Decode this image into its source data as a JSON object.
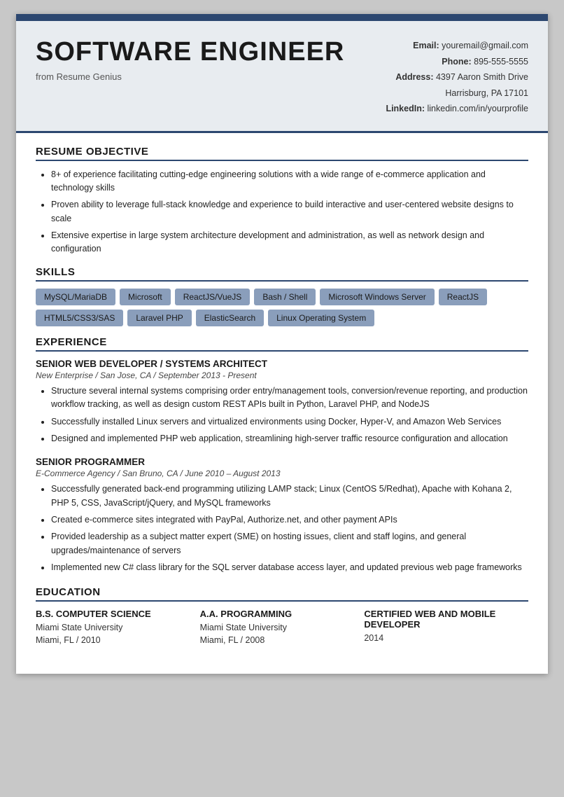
{
  "header": {
    "title": "SOFTWARE ENGINEER",
    "subtitle": "from Resume Genius",
    "contact": {
      "email_label": "Email:",
      "email_value": "youremail@gmail.com",
      "phone_label": "Phone:",
      "phone_value": "895-555-5555",
      "address_label": "Address:",
      "address_line1": "4397 Aaron Smith Drive",
      "address_line2": "Harrisburg, PA 17101",
      "linkedin_label": "LinkedIn:",
      "linkedin_value": "linkedin.com/in/yourprofile"
    }
  },
  "sections": {
    "objective": {
      "title": "RESUME OBJECTIVE",
      "bullets": [
        "8+ of experience facilitating cutting-edge engineering solutions with a wide range of e-commerce application and technology skills",
        "Proven ability to leverage full-stack knowledge and experience to build interactive and user-centered website designs to scale",
        "Extensive expertise in large system architecture development and administration, as well as network design and configuration"
      ]
    },
    "skills": {
      "title": "SKILLS",
      "tags": [
        "MySQL/MariaDB",
        "Microsoft",
        "ReactJS/VueJS",
        "Bash / Shell",
        "Microsoft Windows Server",
        "ReactJS",
        "HTML5/CSS3/SAS",
        "Laravel PHP",
        "ElasticSearch",
        "Linux Operating System"
      ]
    },
    "experience": {
      "title": "EXPERIENCE",
      "jobs": [
        {
          "title": "SENIOR WEB DEVELOPER / SYSTEMS ARCHITECT",
          "meta": "New Enterprise / San Jose, CA / September 2013 - Present",
          "bullets": [
            "Structure several internal systems comprising order entry/management tools, conversion/revenue reporting, and production workflow tracking, as well as design custom REST APIs built in Python, Laravel PHP, and NodeJS",
            "Successfully installed Linux servers and virtualized environments using Docker, Hyper-V, and Amazon Web Services",
            "Designed and implemented PHP web application, streamlining high-server traffic resource configuration and allocation"
          ]
        },
        {
          "title": "SENIOR PROGRAMMER",
          "meta": "E-Commerce Agency / San Bruno, CA / June 2010 – August 2013",
          "bullets": [
            "Successfully generated back-end programming utilizing LAMP stack; Linux (CentOS 5/Redhat), Apache with Kohana 2, PHP 5, CSS, JavaScript/jQuery, and MySQL frameworks",
            "Created e-commerce sites integrated with PayPal, Authorize.net, and other payment APIs",
            "Provided leadership as a subject matter expert (SME) on hosting issues, client and staff logins, and general upgrades/maintenance of servers",
            "Implemented new C# class library for the SQL server database access layer, and updated previous web page frameworks"
          ]
        }
      ]
    },
    "education": {
      "title": "EDUCATION",
      "items": [
        {
          "degree": "B.S. COMPUTER SCIENCE",
          "school": "Miami State University",
          "location_year": "Miami, FL / 2010"
        },
        {
          "degree": "A.A. PROGRAMMING",
          "school": "Miami State University",
          "location_year": "Miami, FL / 2008"
        },
        {
          "degree": "CERTIFIED WEB AND MOBILE DEVELOPER",
          "school": "",
          "location_year": "2014"
        }
      ]
    }
  }
}
